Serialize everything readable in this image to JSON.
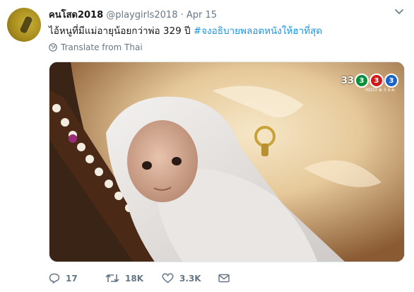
{
  "tweet": {
    "display_name": "คนโสด2018",
    "handle": "@playgirls2018",
    "separator": "·",
    "date": "Apr 15",
    "text_plain": "ไอ้หนูที่มีแม่อายุน้อยกว่าพ่อ 329 ปี ",
    "hashtag": "#จงอธิบายพลอตหนังให้ฮาที่สุด",
    "translate_label": "Translate from Thai"
  },
  "media": {
    "channel_number": "33",
    "channel_sub": "HD33 ⊕ 3 ส.ค.",
    "logo_digits": [
      "3",
      "3",
      "3"
    ]
  },
  "actions": {
    "replies": "17",
    "retweets": "18K",
    "likes": "3.3K"
  },
  "icons": [
    "chevron-down-icon",
    "globe-icon",
    "reply-icon",
    "retweet-icon",
    "heart-icon",
    "mail-icon"
  ],
  "colors": {
    "hashtag": "#1b95e0",
    "secondary": "#657786"
  }
}
